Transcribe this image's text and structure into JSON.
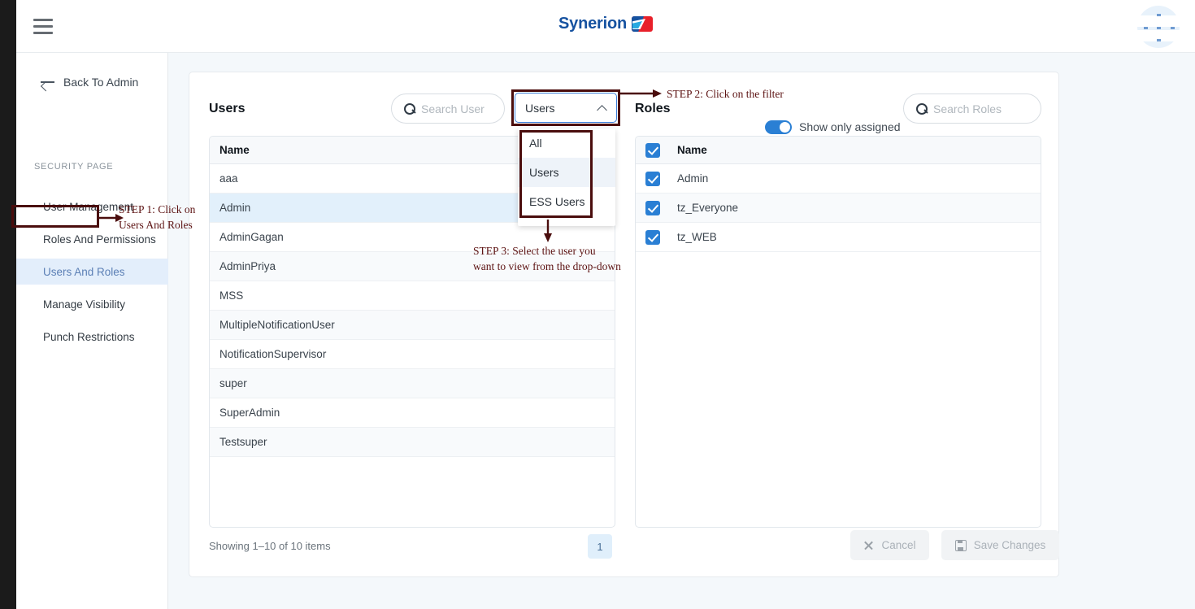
{
  "topbar": {
    "menu_icon": "hamburger-icon",
    "brand": "Synerion",
    "avatar_icon": "user-avatar"
  },
  "sidebar": {
    "back_label": "Back To Admin",
    "back_icon": "arrow-left-icon",
    "section_label": "SECURITY PAGE",
    "items": [
      {
        "label": "User Management",
        "active": false
      },
      {
        "label": "Roles And Permissions",
        "active": false
      },
      {
        "label": "Users And Roles",
        "active": true
      },
      {
        "label": "Manage Visibility",
        "active": false
      },
      {
        "label": "Punch Restrictions",
        "active": false
      }
    ]
  },
  "users_panel": {
    "title": "Users",
    "search": {
      "placeholder": "Search User",
      "value": "",
      "icon": "search-icon"
    },
    "filter": {
      "selected": "Users",
      "chevron_icon": "chevron-up-icon",
      "options": [
        {
          "label": "All",
          "selected": false
        },
        {
          "label": "Users",
          "selected": true
        },
        {
          "label": "ESS Users",
          "selected": false
        }
      ]
    },
    "table": {
      "header": "Name",
      "rows": [
        {
          "name": "aaa",
          "selected": false
        },
        {
          "name": "Admin",
          "selected": true
        },
        {
          "name": "AdminGagan",
          "selected": false
        },
        {
          "name": "AdminPriya",
          "selected": false
        },
        {
          "name": "MSS",
          "selected": false
        },
        {
          "name": "MultipleNotificationUser",
          "selected": false
        },
        {
          "name": "NotificationSupervisor",
          "selected": false
        },
        {
          "name": "super",
          "selected": false
        },
        {
          "name": "SuperAdmin",
          "selected": false
        },
        {
          "name": "Testsuper",
          "selected": false
        }
      ]
    },
    "showing": "Showing 1–10 of 10 items",
    "page": "1"
  },
  "roles_panel": {
    "title": "Roles",
    "toggle": {
      "label": "Show only assigned",
      "on": true
    },
    "search": {
      "placeholder": "Search Roles",
      "value": "",
      "icon": "search-icon"
    },
    "table": {
      "header": "Name",
      "header_checked": true,
      "rows": [
        {
          "name": "Admin",
          "checked": true
        },
        {
          "name": "tz_Everyone",
          "checked": true
        },
        {
          "name": "tz_WEB",
          "checked": true
        }
      ]
    }
  },
  "footer": {
    "cancel_label": "Cancel",
    "cancel_icon": "close-x-icon",
    "save_label": "Save Changes",
    "save_icon": "save-disk-icon"
  },
  "annotations": [
    {
      "id": "step1",
      "text": "STEP 1: Click on\nUsers And Roles"
    },
    {
      "id": "step2",
      "text": "STEP 2: Click on the filter"
    },
    {
      "id": "step3",
      "text": "STEP 3: Select the user you\nwant to view from the drop-down"
    }
  ],
  "colors": {
    "brand_blue": "#1652a0",
    "brand_red": "#e8202a",
    "accent_blue": "#2a7fd4",
    "annotation_maroon": "#4a0d0d",
    "selected_row": "#e2f0fb",
    "page_bg": "#f4f8fb"
  }
}
